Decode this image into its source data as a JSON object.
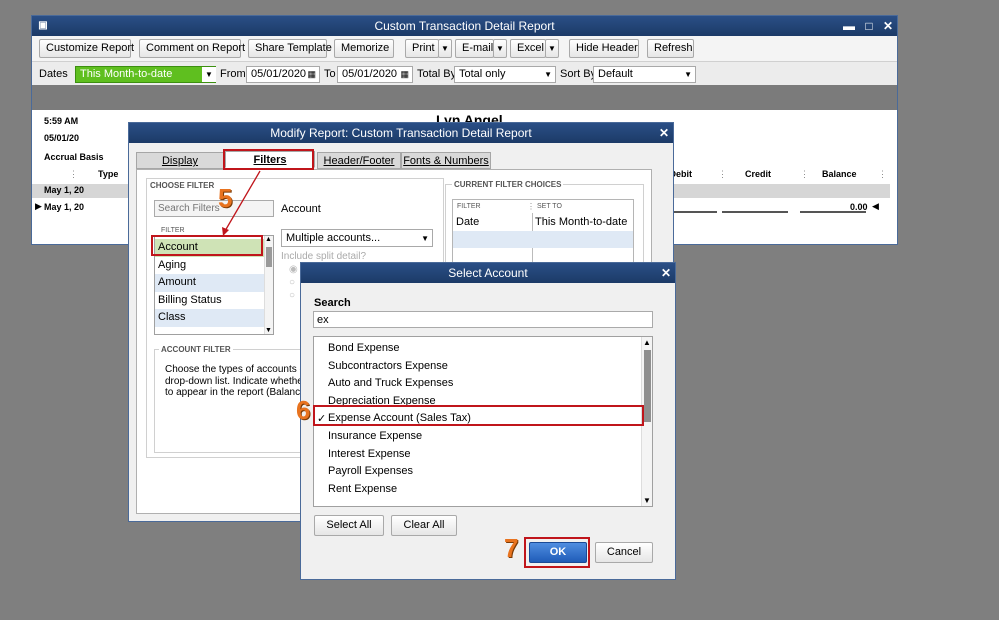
{
  "report_window": {
    "title": "Custom Transaction Detail Report",
    "toolbar": {
      "customize": "Customize Report",
      "comment": "Comment on Report",
      "share": "Share Template",
      "memorize": "Memorize",
      "print": "Print",
      "email": "E-mail",
      "excel": "Excel",
      "hide_header": "Hide Header",
      "refresh": "Refresh"
    },
    "filters": {
      "dates_label": "Dates",
      "dates_value": "This Month-to-date",
      "from_label": "From",
      "from_value": "05/01/2020",
      "to_label": "To",
      "to_value": "05/01/2020",
      "total_by_label": "Total By",
      "total_by_value": "Total only",
      "sort_by_label": "Sort By",
      "sort_by_value": "Default"
    },
    "header": {
      "time": "5:59 AM",
      "date": "05/01/20",
      "basis": "Accrual Basis",
      "company": "Lyn Angel"
    },
    "columns": {
      "type": "Type",
      "debit": "Debit",
      "credit": "Credit",
      "balance": "Balance"
    },
    "rows": [
      {
        "date": "May 1, 20"
      },
      {
        "date": "May 1, 20",
        "balance": "0.00"
      }
    ]
  },
  "modify_dialog": {
    "title": "Modify Report: Custom Transaction Detail Report",
    "tabs": [
      "Display",
      "Filters",
      "Header/Footer",
      "Fonts & Numbers"
    ],
    "choose_filter_label": "CHOOSE FILTER",
    "search_placeholder": "Search Filters",
    "filter_col_label": "FILTER",
    "filter_items": [
      "Account",
      "Aging",
      "Amount",
      "Billing Status",
      "Class"
    ],
    "account_label": "Account",
    "account_value": "Multiple accounts...",
    "include_split": "Include split detail?",
    "account_filter_label": "ACCOUNT FILTER",
    "account_filter_text": "Choose the types of accounts or\ndrop-down list. Indicate whether\nto appear in the report (Balance",
    "current_choices_label": "CURRENT FILTER CHOICES",
    "current_filter_header": "FILTER",
    "current_setto_header": "SET TO",
    "current_rows": [
      {
        "filter": "Date",
        "set_to": "This Month-to-date"
      }
    ]
  },
  "select_account": {
    "title": "Select Account",
    "search_label": "Search",
    "search_value": "ex",
    "accounts": [
      {
        "name": "Bond Expense",
        "checked": false
      },
      {
        "name": "Subcontractors Expense",
        "checked": false
      },
      {
        "name": "Auto and Truck Expenses",
        "checked": false
      },
      {
        "name": "Depreciation Expense",
        "checked": false
      },
      {
        "name": "Expense Account (Sales Tax)",
        "checked": true
      },
      {
        "name": "Insurance Expense",
        "checked": false
      },
      {
        "name": "Interest Expense",
        "checked": false
      },
      {
        "name": "Payroll Expenses",
        "checked": false
      },
      {
        "name": "Rent Expense",
        "checked": false
      }
    ],
    "check_mark": "✓",
    "select_all": "Select All",
    "clear_all": "Clear All",
    "ok": "OK",
    "cancel": "Cancel"
  },
  "annotations": {
    "step5": "5",
    "step6": "6",
    "step7": "7",
    "highlight_color": "#c0151b",
    "step_color": "#e8731f"
  }
}
